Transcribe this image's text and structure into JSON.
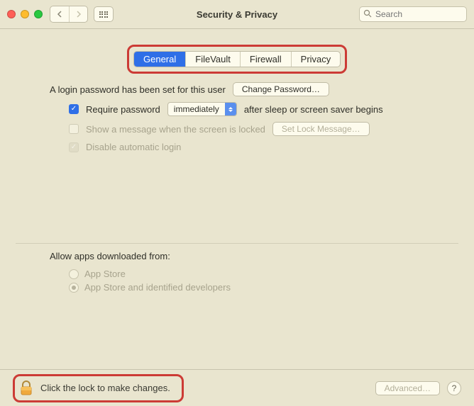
{
  "window": {
    "title": "Security & Privacy",
    "search_placeholder": "Search"
  },
  "tabs": {
    "general": "General",
    "filevault": "FileVault",
    "firewall": "Firewall",
    "privacy": "Privacy",
    "active": "general"
  },
  "password": {
    "set_text": "A login password has been set for this user",
    "change_button": "Change Password…",
    "require_label": "Require password",
    "require_dropdown": "immediately",
    "require_after": "after sleep or screen saver begins",
    "show_message": "Show a message when the screen is locked",
    "set_lock_message": "Set Lock Message…",
    "disable_auto_login": "Disable automatic login"
  },
  "apps": {
    "heading": "Allow apps downloaded from:",
    "option_appstore": "App Store",
    "option_identified": "App Store and identified developers",
    "selected": "identified"
  },
  "footer": {
    "lock_text": "Click the lock to make changes.",
    "advanced": "Advanced…",
    "help": "?"
  }
}
